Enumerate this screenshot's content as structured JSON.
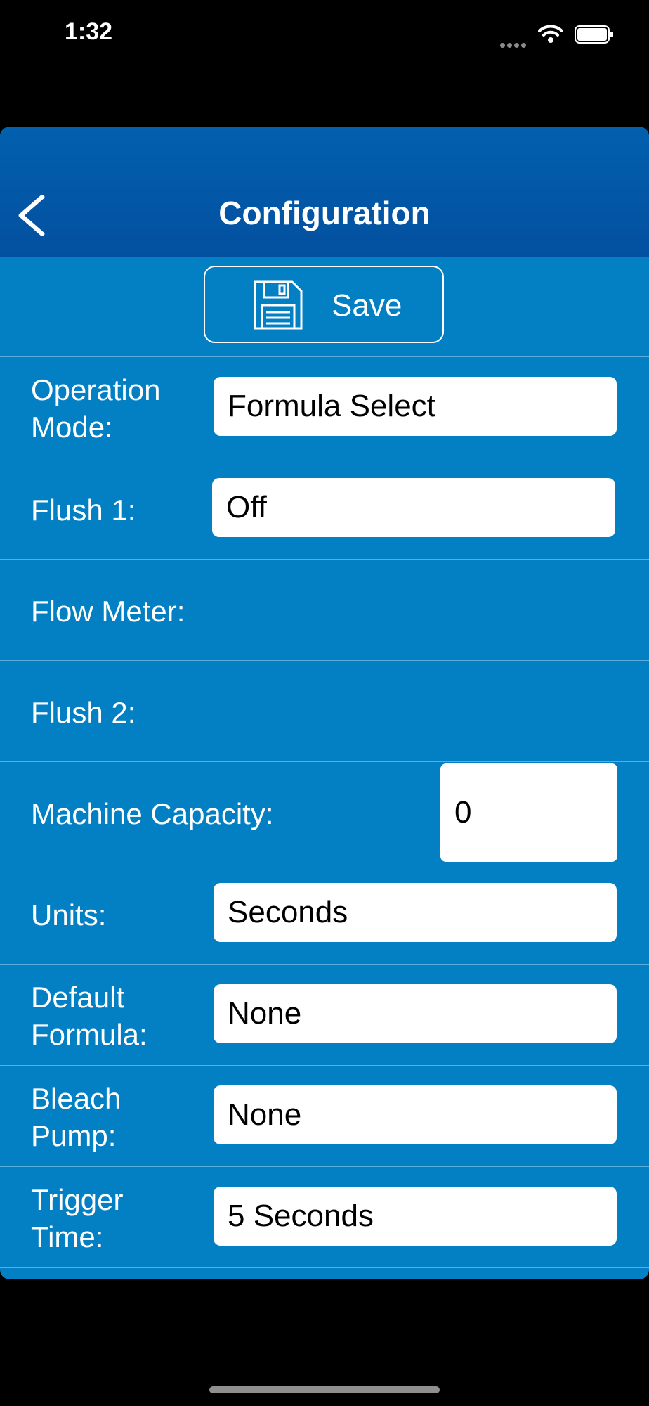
{
  "status_bar": {
    "time": "1:32"
  },
  "nav": {
    "title": "Configuration"
  },
  "toolbar": {
    "save_label": "Save"
  },
  "rows": [
    {
      "label": "Operation Mode:",
      "value": "Formula Select"
    },
    {
      "label": "Flush 1:",
      "value": "Off"
    },
    {
      "label": "Flow Meter:"
    },
    {
      "label": "Flush 2:"
    },
    {
      "label": "Machine Capacity:",
      "value": "0"
    },
    {
      "label": "Units:",
      "value": "Seconds"
    },
    {
      "label": "Default Formula:",
      "value": "None"
    },
    {
      "label": "Bleach Pump:",
      "value": "None"
    },
    {
      "label": "Trigger Time:",
      "value": "5 Seconds"
    }
  ],
  "colors": {
    "background": "#000000",
    "panel": "#0380c4",
    "nav_bar": "#0350a0",
    "field": "#ffffff"
  },
  "icons": [
    "chevron-left-icon",
    "floppy-disk-icon",
    "wifi-icon",
    "battery-icon",
    "signal-dots-icon"
  ]
}
